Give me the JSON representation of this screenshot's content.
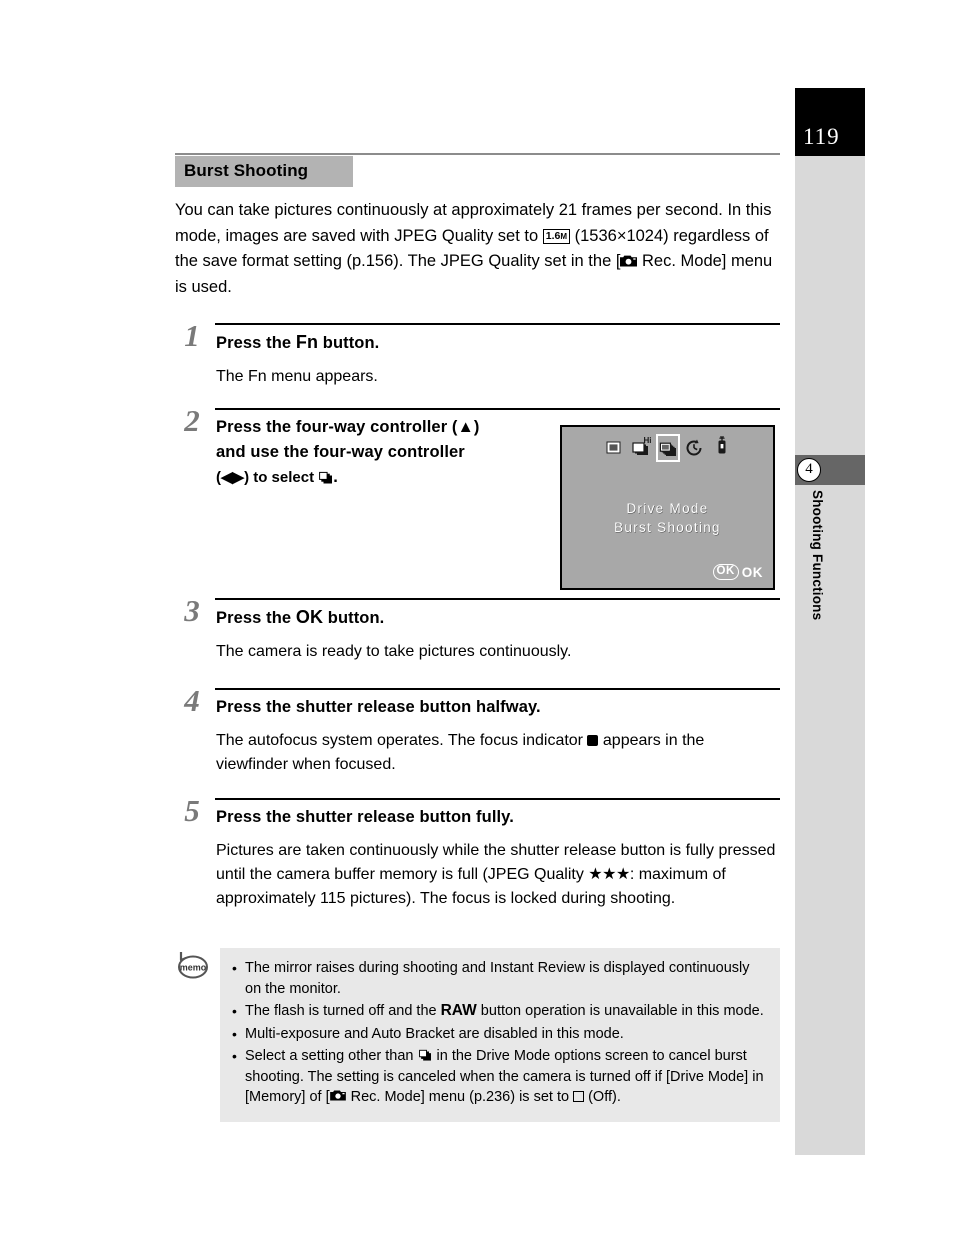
{
  "page": {
    "number": "119",
    "chapter_number": "4",
    "chapter_label": "Shooting Functions"
  },
  "section": {
    "heading": "Burst Shooting",
    "intro_part1": "You can take pictures continuously at approximately 21 frames per second. In this mode, images are saved with JPEG Quality set to ",
    "intro_badge": "1.6",
    "intro_badge_sub": "M",
    "intro_part2": " (1536×1024) regardless of the save format setting (p.156). The JPEG Quality set in the [",
    "intro_part3": " Rec. Mode] menu is used."
  },
  "steps": [
    {
      "number": "1",
      "title_pre": "Press the ",
      "title_kbd": "Fn",
      "title_post": " button.",
      "desc": "The Fn menu appears."
    },
    {
      "number": "2",
      "title_line1": "Press the four-way controller (▲)",
      "title_line2": "and use the four-way controller",
      "title_line3_pre": "(◀▶) to select ",
      "title_line3_post": "."
    },
    {
      "number": "3",
      "title_pre": "Press the ",
      "title_kbd": "OK",
      "title_post": " button.",
      "desc": "The camera is ready to take pictures continuously."
    },
    {
      "number": "4",
      "title": "Press the shutter release button halfway.",
      "desc_pre": "The autofocus system operates. The focus indicator ",
      "desc_post": " appears in the viewfinder when focused."
    },
    {
      "number": "5",
      "title": "Press the shutter release button fully.",
      "desc_pre": "Pictures are taken continuously while the shutter release button is fully pressed until the camera buffer memory is full (JPEG Quality ",
      "desc_stars": "★★★",
      "desc_post": ": maximum of approximately 115 pictures). The focus is locked during shooting."
    }
  ],
  "lcd": {
    "icons": [
      {
        "name": "single-frame-icon",
        "selected": false
      },
      {
        "name": "continuous-hi-icon",
        "selected": false
      },
      {
        "name": "burst-icon",
        "selected": true
      },
      {
        "name": "self-timer-icon",
        "selected": false
      },
      {
        "name": "remote-control-icon",
        "selected": false
      }
    ],
    "title": "Drive Mode",
    "subtitle": "Burst Shooting",
    "ok_badge": "OK",
    "ok_label": "OK"
  },
  "memo": {
    "icon_label": "memo",
    "items": [
      {
        "text": "The mirror raises during shooting and Instant Review is displayed continuously on the monitor."
      },
      {
        "pre": "The flash is turned off and the ",
        "kbd": "RAW",
        "post": " button operation is unavailable in this mode."
      },
      {
        "text": "Multi-exposure and Auto Bracket are disabled in this mode."
      },
      {
        "pre": "Select a setting other than ",
        "mid": " in the Drive Mode options screen to cancel burst shooting. The setting is canceled when the camera is turned off if [Drive Mode] in [Memory] of [",
        "mid2": " Rec. Mode] menu (p.236) is set to ",
        "post": " (Off)."
      }
    ]
  },
  "colors": {
    "heading_background": "#b3b3b3",
    "sidebar_background": "#d9d9d9",
    "chapter_tab_background": "#666666",
    "page_box_background": "#000000",
    "memo_background": "#e8e8e8",
    "lcd_background": "#a8a8a8",
    "step_number": "#7a7a7a"
  }
}
